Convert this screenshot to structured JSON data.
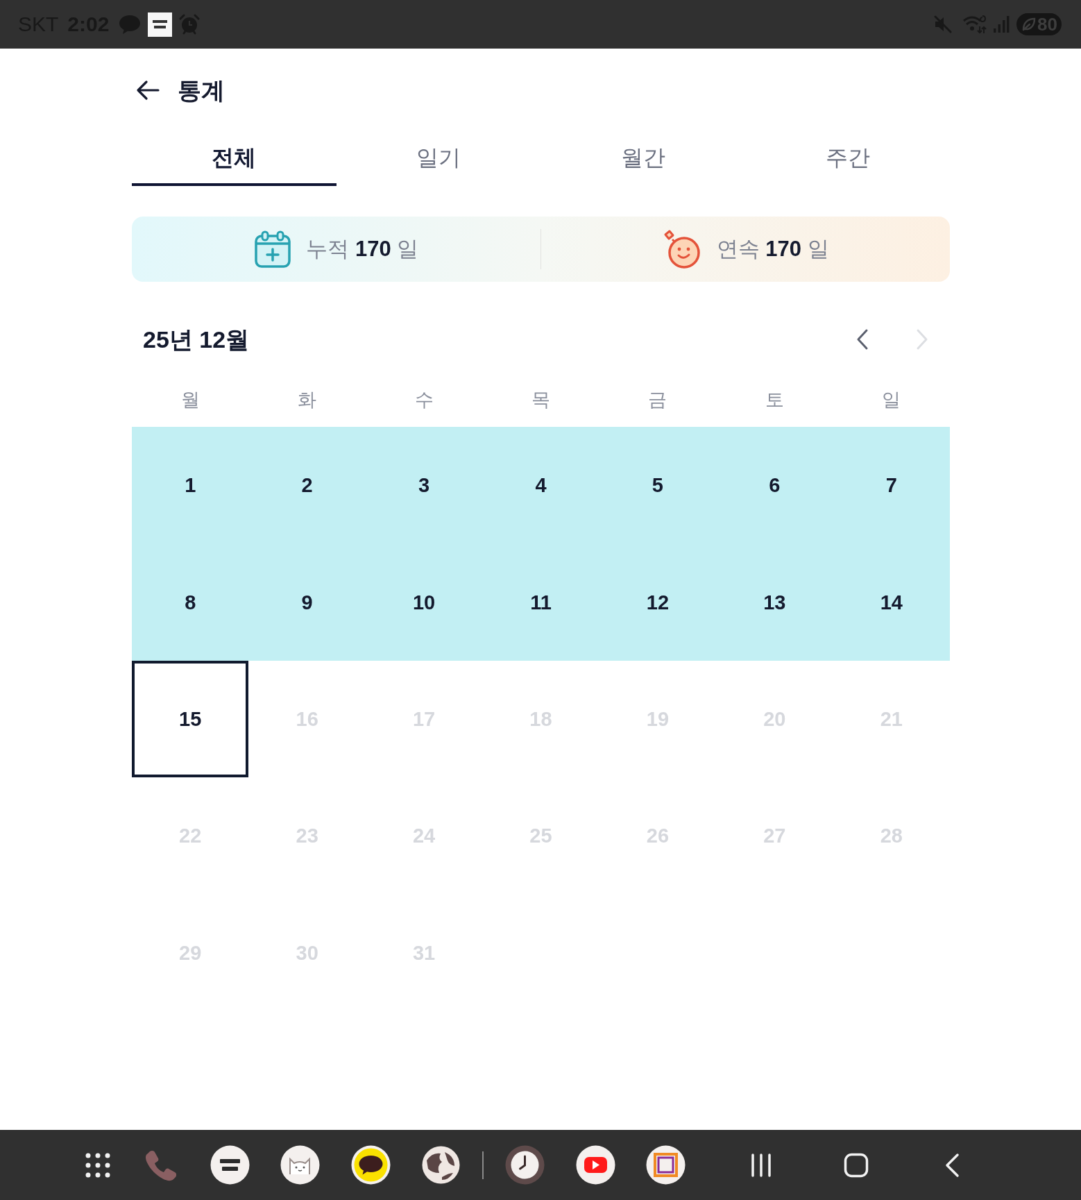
{
  "status_bar": {
    "carrier": "SKT",
    "time": "2:02",
    "battery": "80"
  },
  "header": {
    "title": "통계"
  },
  "tabs": [
    {
      "label": "전체",
      "selected": true
    },
    {
      "label": "일기",
      "selected": false
    },
    {
      "label": "월간",
      "selected": false
    },
    {
      "label": "주간",
      "selected": false
    }
  ],
  "summary": [
    {
      "kind": "calendar",
      "text": "누적 **170** 일"
    },
    {
      "kind": "smiley",
      "text": "연속 **170** 일"
    }
  ],
  "calendar": {
    "title": "25년 12월",
    "nav": [
      {
        "kind": "prev",
        "disabled": false
      },
      {
        "kind": "next",
        "disabled": true
      }
    ],
    "weekdays": [
      "월",
      "화",
      "수",
      "목",
      "금",
      "토",
      "일"
    ],
    "days": [
      {
        "label": "1",
        "recorded": true,
        "selected": false,
        "disabled": false
      },
      {
        "label": "2",
        "recorded": true,
        "selected": false,
        "disabled": false
      },
      {
        "label": "3",
        "recorded": true,
        "selected": false,
        "disabled": false
      },
      {
        "label": "4",
        "recorded": true,
        "selected": false,
        "disabled": false
      },
      {
        "label": "5",
        "recorded": true,
        "selected": false,
        "disabled": false
      },
      {
        "label": "6",
        "recorded": true,
        "selected": false,
        "disabled": false
      },
      {
        "label": "7",
        "recorded": true,
        "selected": false,
        "disabled": false
      },
      {
        "label": "8",
        "recorded": true,
        "selected": false,
        "disabled": false
      },
      {
        "label": "9",
        "recorded": true,
        "selected": false,
        "disabled": false
      },
      {
        "label": "10",
        "recorded": true,
        "selected": false,
        "disabled": false
      },
      {
        "label": "11",
        "recorded": true,
        "selected": false,
        "disabled": false
      },
      {
        "label": "12",
        "recorded": true,
        "selected": false,
        "disabled": false
      },
      {
        "label": "13",
        "recorded": true,
        "selected": false,
        "disabled": false
      },
      {
        "label": "14",
        "recorded": true,
        "selected": false,
        "disabled": false
      },
      {
        "label": "15",
        "recorded": false,
        "selected": true,
        "disabled": false
      },
      {
        "label": "16",
        "recorded": false,
        "selected": false,
        "disabled": true
      },
      {
        "label": "17",
        "recorded": false,
        "selected": false,
        "disabled": true
      },
      {
        "label": "18",
        "recorded": false,
        "selected": false,
        "disabled": true
      },
      {
        "label": "19",
        "recorded": false,
        "selected": false,
        "disabled": true
      },
      {
        "label": "20",
        "recorded": false,
        "selected": false,
        "disabled": true
      },
      {
        "label": "21",
        "recorded": false,
        "selected": false,
        "disabled": true
      },
      {
        "label": "22",
        "recorded": false,
        "selected": false,
        "disabled": true
      },
      {
        "label": "23",
        "recorded": false,
        "selected": false,
        "disabled": true
      },
      {
        "label": "24",
        "recorded": false,
        "selected": false,
        "disabled": true
      },
      {
        "label": "25",
        "recorded": false,
        "selected": false,
        "disabled": true
      },
      {
        "label": "26",
        "recorded": false,
        "selected": false,
        "disabled": true
      },
      {
        "label": "27",
        "recorded": false,
        "selected": false,
        "disabled": true
      },
      {
        "label": "28",
        "recorded": false,
        "selected": false,
        "disabled": true
      },
      {
        "label": "29",
        "recorded": false,
        "selected": false,
        "disabled": true
      },
      {
        "label": "30",
        "recorded": false,
        "selected": false,
        "disabled": true
      },
      {
        "label": "31",
        "recorded": false,
        "selected": false,
        "disabled": true
      }
    ]
  }
}
